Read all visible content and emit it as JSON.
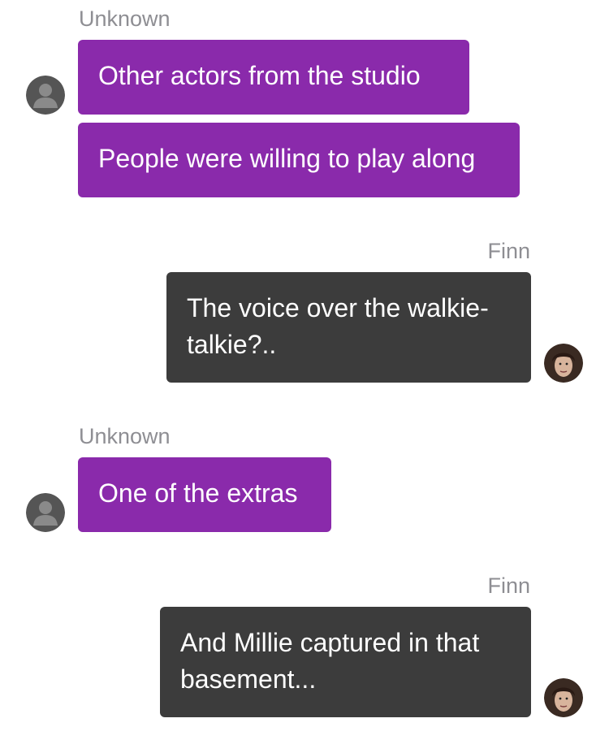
{
  "messages": [
    {
      "sender": "Unknown",
      "side": "in",
      "bubbles": [
        "Other actors from the studio",
        "People were willing to play along"
      ],
      "avatar_icon": "default-person-icon"
    },
    {
      "sender": "Finn",
      "side": "out",
      "bubbles": [
        "The voice over the walkie-talkie?.."
      ],
      "avatar_icon": "finn-portrait-icon"
    },
    {
      "sender": "Unknown",
      "side": "in",
      "bubbles": [
        "One of the extras"
      ],
      "avatar_icon": "default-person-icon"
    },
    {
      "sender": "Finn",
      "side": "out",
      "bubbles": [
        "And Millie captured in that basement..."
      ],
      "avatar_icon": "finn-portrait-icon"
    }
  ],
  "colors": {
    "incoming_bubble": "#8a2aab",
    "outgoing_bubble": "#3c3c3c",
    "sender_label": "#8e8e93",
    "background": "#ffffff"
  }
}
